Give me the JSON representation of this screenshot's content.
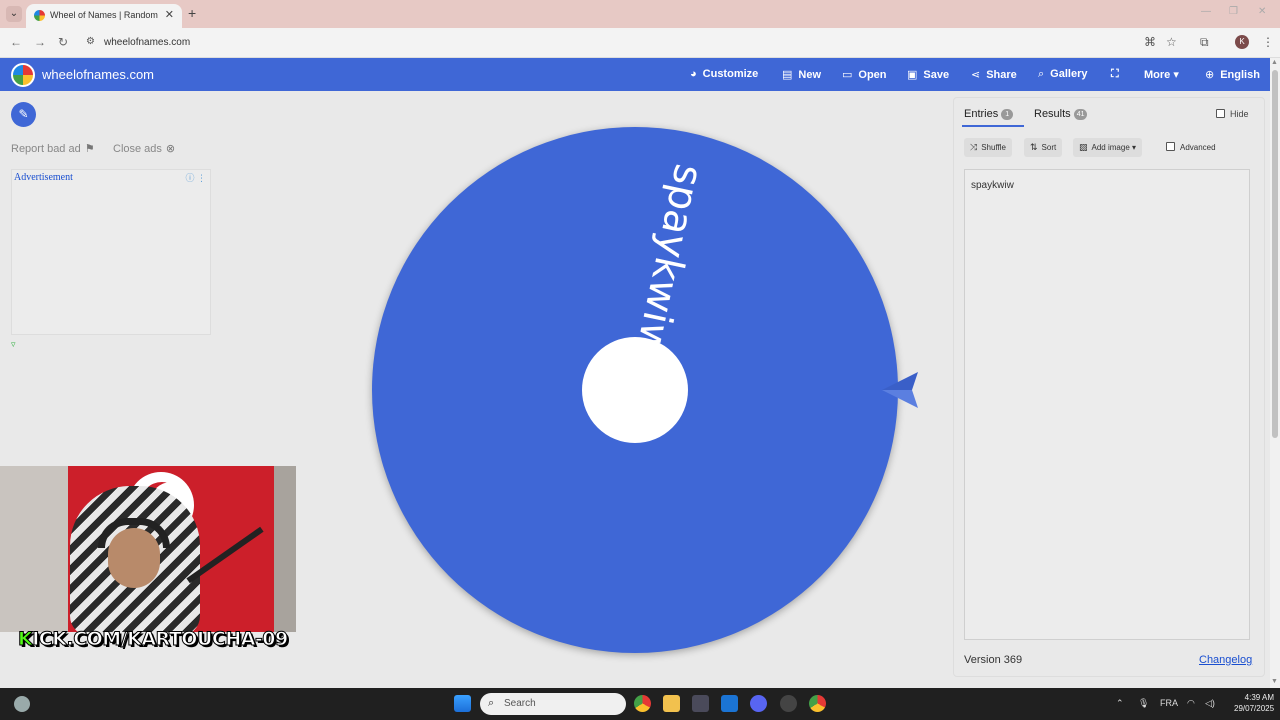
{
  "browser": {
    "tab_title": "Wheel of Names | Random nan",
    "url": "wheelofnames.com"
  },
  "site": {
    "brand": "wheelofnames.com",
    "menu": {
      "customize": "Customize",
      "new": "New",
      "open": "Open",
      "save": "Save",
      "share": "Share",
      "gallery": "Gallery",
      "more": "More",
      "language": "English"
    },
    "accent": "#3f67d6"
  },
  "ads": {
    "report": "Report bad ad",
    "close": "Close ads",
    "placeholder": "Advertisement"
  },
  "wheel": {
    "entry_label": "spaykwiw",
    "color": "#3f67d6"
  },
  "panel": {
    "tabs": {
      "entries": "Entries",
      "entries_count": "1",
      "results": "Results",
      "results_count": "41"
    },
    "hide": "Hide",
    "tools": {
      "shuffle": "Shuffle",
      "sort": "Sort",
      "add_image": "Add image",
      "advanced": "Advanced"
    },
    "entries_text": "spaykwiw",
    "version": "Version 369",
    "changelog": "Changelog"
  },
  "stream": {
    "kick_k": "K",
    "kick_rest": "ICK.COM/KARTOUCHA-09"
  },
  "taskbar": {
    "search": "Search",
    "lang": "FRA",
    "time": "4:39 AM",
    "date": "29/07/2025"
  }
}
